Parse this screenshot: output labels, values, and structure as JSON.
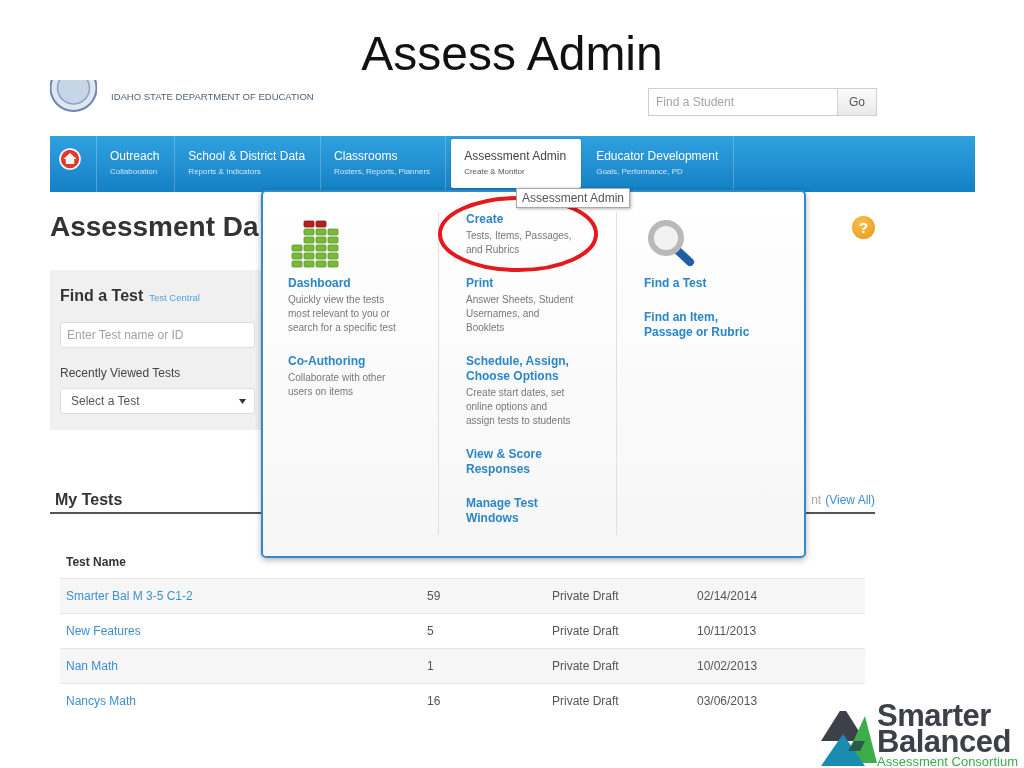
{
  "slide": {
    "title": "Assess Admin"
  },
  "header": {
    "agency": "IDAHO STATE DEPARTMENT OF EDUCATION",
    "student_search": {
      "placeholder": "Find a Student"
    },
    "go_button": "Go"
  },
  "nav": {
    "items": [
      {
        "label": "Outreach",
        "sublabel": "Collaboration",
        "selected": false
      },
      {
        "label": "School & District Data",
        "sublabel": "Reports & Indicators",
        "selected": false
      },
      {
        "label": "Classrooms",
        "sublabel": "Rosters, Reports, Planners",
        "selected": false
      },
      {
        "label": "Assessment Admin",
        "sublabel": "Create & Monitor",
        "selected": true
      },
      {
        "label": "Educator Development",
        "sublabel": "Goals, Performance, PD",
        "selected": false
      }
    ]
  },
  "tooltip": {
    "text": "Assessment Admin"
  },
  "page": {
    "title": "Assessment Da",
    "help": "?"
  },
  "find_a_test": {
    "title": "Find a Test",
    "link": "Test Central",
    "search": {
      "placeholder": "Enter Test name or ID"
    },
    "recent_label": "Recently Viewed Tests",
    "recent_select": {
      "value": "Select a Test"
    }
  },
  "my_tests": {
    "title": "My Tests",
    "fragment": "nt",
    "link": "(View All)",
    "columns": [
      "Test Name"
    ],
    "rows": [
      {
        "cells": [
          "Smarter Bal M 3-5 C1-2",
          "59",
          "Private Draft",
          "02/14/2014"
        ]
      },
      {
        "cells": [
          "New Features",
          "5",
          "Private Draft",
          "10/11/2013"
        ]
      },
      {
        "cells": [
          "Nan Math",
          "1",
          "Private Draft",
          "10/02/2013"
        ]
      },
      {
        "cells": [
          "Nancys Math",
          "16",
          "Private Draft",
          "03/06/2013"
        ]
      }
    ]
  },
  "menu": {
    "columns": [
      {
        "items": [
          {
            "title": "Dashboard",
            "description": "Quickly view the tests most relevant to you or search for a specific test",
            "circled": false
          },
          {
            "title": "Co-Authoring",
            "description": "Collaborate with other users on items",
            "circled": false
          }
        ]
      },
      {
        "items": [
          {
            "title": "Create",
            "description": "Tests, Items, Passages, and Rubrics",
            "circled": true
          },
          {
            "title": "Print",
            "description": "Answer Sheets, Student Usernames, and Booklets",
            "circled": false
          },
          {
            "title": "Schedule, Assign, Choose Options",
            "description": "Create start dates, set online options and assign tests to students",
            "circled": false
          },
          {
            "title": "View & Score Responses",
            "circled": false
          },
          {
            "title": "Manage Test Windows",
            "circled": false
          }
        ]
      },
      {
        "items": [
          {
            "title": "Find a Test",
            "circled": false
          },
          {
            "title": "Find an Item, Passage or Rubric",
            "circled": false
          }
        ]
      }
    ]
  },
  "logo": {
    "line_1": "Smarter",
    "line_2": "Balanced",
    "tagline": "Assessment Consortium"
  }
}
